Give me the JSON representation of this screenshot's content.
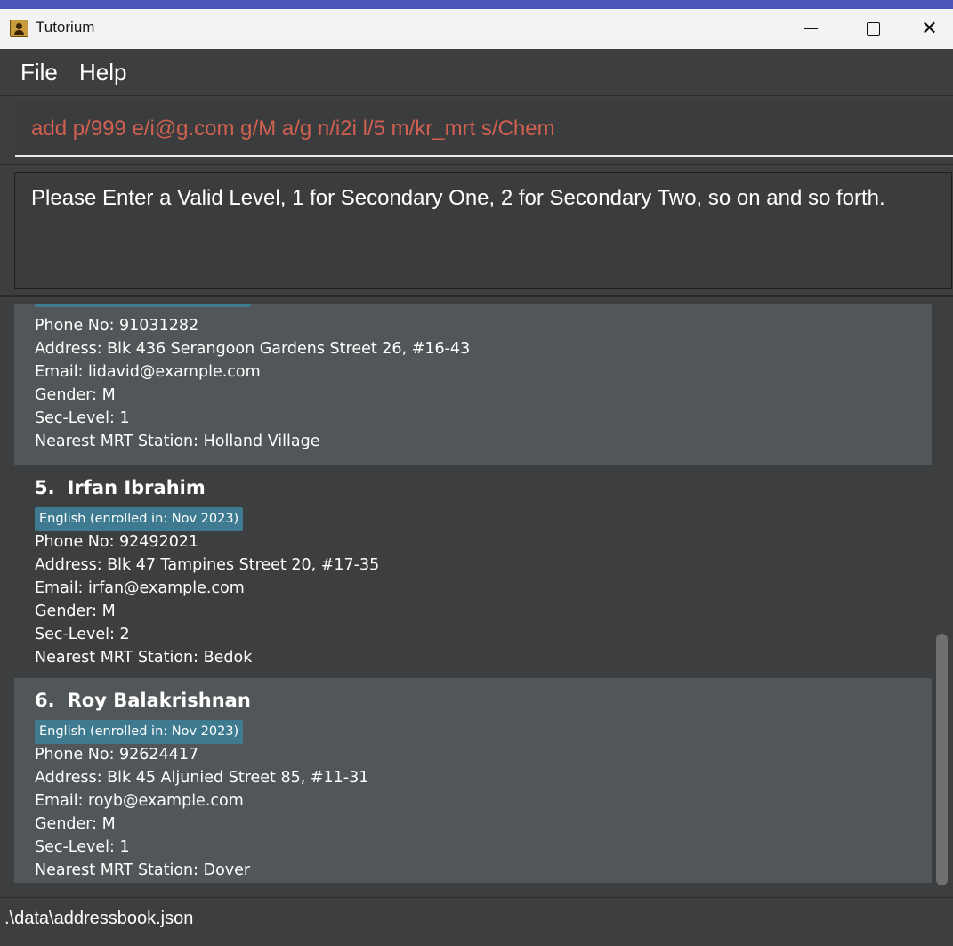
{
  "window": {
    "title": "Tutorium",
    "icon": "address-book-icon"
  },
  "menu": {
    "file": "File",
    "help": "Help"
  },
  "command": {
    "value": "add p/999 e/i@g.com g/M a/g n/i2i l/5 m/kr_mrt s/Chem"
  },
  "result": {
    "message": "Please Enter a Valid Level, 1 for Secondary One, 2 for Secondary Two, so on and so forth."
  },
  "persons": [
    {
      "phone": "Phone No: 91031282",
      "address": "Address: Blk 436 Serangoon Gardens Street 26, #16-43",
      "email": "Email: lidavid@example.com",
      "gender": "Gender: M",
      "level": "Sec-Level: 1",
      "mrt": "Nearest MRT Station: Holland Village"
    },
    {
      "index": "5.",
      "name": "Irfan Ibrahim",
      "tag": "English (enrolled in: Nov 2023)",
      "phone": "Phone No: 92492021",
      "address": "Address: Blk 47 Tampines Street 20, #17-35",
      "email": "Email: irfan@example.com",
      "gender": "Gender: M",
      "level": "Sec-Level: 2",
      "mrt": "Nearest MRT Station: Bedok"
    },
    {
      "index": "6.",
      "name": "Roy Balakrishnan",
      "tag": "English (enrolled in: Nov 2023)",
      "phone": "Phone No: 92624417",
      "address": "Address: Blk 45 Aljunied Street 85, #11-31",
      "email": "Email: royb@example.com",
      "gender": "Gender: M",
      "level": "Sec-Level: 1",
      "mrt": "Nearest MRT Station: Dover"
    }
  ],
  "status": {
    "path": ".\\data\\addressbook.json"
  },
  "colors": {
    "background": "#3c3e40",
    "card_light": "#515658",
    "tag": "#3e7b91",
    "command_text": "#d0604f"
  }
}
